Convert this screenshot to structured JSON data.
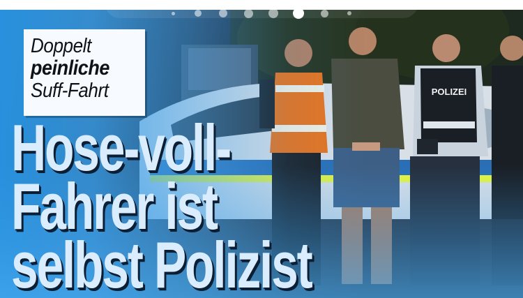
{
  "pager": {
    "total": 8,
    "active_index": 5
  },
  "kicker": {
    "line1": "Doppelt",
    "line2": "peinliche",
    "line3": "Suff-Fahrt"
  },
  "headline": {
    "line1": "Hose-voll-",
    "line2": "Fahrer ist",
    "line3": "selbst Polizist"
  },
  "photo": {
    "vest_label": "POLIZEI"
  },
  "colors": {
    "accent_blue": "#3fa2e8",
    "headline_text": "#d9edff",
    "kicker_bg": "#f7fbff",
    "police_vest": "#1a1f26",
    "safety_vest": "#e8731d"
  }
}
